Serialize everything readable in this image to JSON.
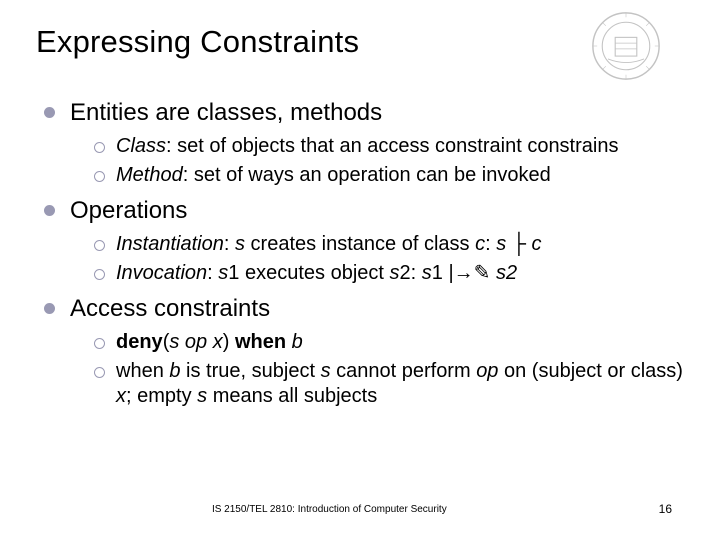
{
  "title": "Expressing Constraints",
  "bullets": [
    {
      "text": "Entities are classes, methods",
      "sub": [
        {
          "term": "Class",
          "rest": ": set of objects that an access constraint constrains"
        },
        {
          "term": "Method",
          "rest": ": set of ways an operation can be invoked"
        }
      ]
    },
    {
      "text": "Operations",
      "sub": [
        {
          "term": "Instantiation",
          "p0": ": ",
          "i0": "s",
          "p1": " creates instance of class ",
          "i1": "c",
          "p2": ": ",
          "i2": "s",
          "p3": " ├ ",
          "i3": "c"
        },
        {
          "term": "Invocation",
          "p0": ": ",
          "i0": "s",
          "p1": "1 executes object ",
          "i1": "s",
          "p2": "2: ",
          "i2": "s",
          "p3": "1 |→✎ ",
          "i3": "s2"
        }
      ]
    },
    {
      "text": "Access constraints",
      "sub": [
        {
          "b0": "deny",
          "p0": "(",
          "i0": "s op x",
          "p1": ") ",
          "b1": "when",
          "p2": " ",
          "i1": "b"
        },
        {
          "p0": "when ",
          "i0": "b",
          "p1": " is true, subject ",
          "i1": "s",
          "p2": " cannot perform ",
          "i2": "op",
          "p3": " on (subject or class) ",
          "i3": "x",
          "p4": "; empty ",
          "i4": "s",
          "p5": " means all subjects"
        }
      ]
    }
  ],
  "footer": {
    "course": "IS 2150/TEL 2810: Introduction of Computer Security",
    "page": "16"
  }
}
